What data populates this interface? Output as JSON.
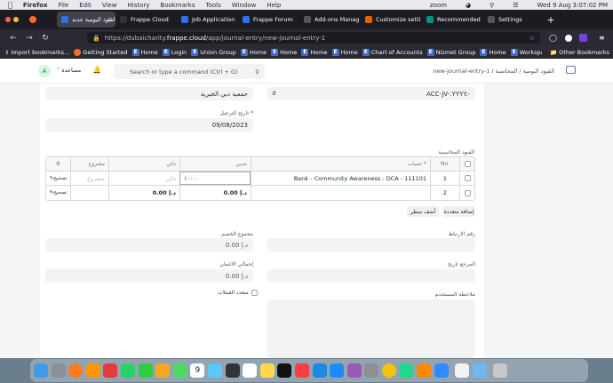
{
  "menubar": {
    "app": "Firefox",
    "items": [
      "File",
      "Edit",
      "View",
      "History",
      "Bookmarks",
      "Tools",
      "Window",
      "Help"
    ],
    "zoom": "zoom",
    "clock": "Wed 9 Aug  3:07:02 PM"
  },
  "tabs": [
    {
      "label": "القيود اليومية جديد -",
      "color": "#2e73e8",
      "active": true
    },
    {
      "label": "Frappe Cloud",
      "color": "#333"
    },
    {
      "label": "Job Application",
      "color": "#2e73e8"
    },
    {
      "label": "Frappe Forum",
      "color": "#2e73e8"
    },
    {
      "label": "Add-ons Manag",
      "color": "#555"
    },
    {
      "label": "Customize setti",
      "color": "#e66000"
    },
    {
      "label": "Recommended",
      "color": "#0a8f88"
    },
    {
      "label": "Settings",
      "color": "#555"
    }
  ],
  "url": {
    "prefix": "https://dubaicharity.",
    "domain": "frappe.cloud",
    "path": "/app/journal-entry/new-journal-entry-1"
  },
  "bookmarks": [
    {
      "label": "Import bookmarks...",
      "icon": "import-icon"
    },
    {
      "label": "Getting Started",
      "icon": "firefox-icon"
    },
    {
      "label": "Home",
      "icon": "e-icon"
    },
    {
      "label": "Login",
      "icon": "e-icon"
    },
    {
      "label": "Union Group",
      "icon": "e-icon"
    },
    {
      "label": "Home",
      "icon": "e-icon"
    },
    {
      "label": "Home",
      "icon": "e-icon"
    },
    {
      "label": "Home",
      "icon": "e-icon"
    },
    {
      "label": "Home",
      "icon": "e-icon"
    },
    {
      "label": "Chart of Accounts",
      "icon": "e-icon"
    },
    {
      "label": "Nizmet Group",
      "icon": "e-icon"
    },
    {
      "label": "Home",
      "icon": "e-icon"
    },
    {
      "label": "Workspace",
      "icon": "e-icon"
    },
    {
      "label": "Buying",
      "icon": "e-icon"
    },
    {
      "label": "Workspace",
      "icon": "e-icon"
    },
    {
      "label": "Home",
      "icon": "e-icon"
    }
  ],
  "other_bookmarks": "Other Bookmarks",
  "topnav": {
    "avatar": "A",
    "help": "مساعدة",
    "search_placeholder": "Search or type a command (Ctrl + G)",
    "breadcrumb": "new-journal-entry-1 / القيود اليومية / المحاسبة"
  },
  "form": {
    "series_value": "ACC-JV-.YYYY.-",
    "company_value": "جمعية دبي الخيرية",
    "posting_date_label": "تاريخ الترحيل *",
    "posting_date_value": "09/08/2023",
    "accounts_label": "القيود المحاسبية",
    "table_headers": {
      "no": "No.",
      "account": "حساب *",
      "debit": "مدين",
      "credit": "دائن",
      "project": "مشروع"
    },
    "rows": [
      {
        "no": "1",
        "account": "Bank - Community Awareness - DCA - 111101",
        "debit": "١٠٠٠",
        "credit": "دائن",
        "project": "مشروع",
        "edit": "تصحيح"
      },
      {
        "no": "2",
        "account": "",
        "debit": "",
        "credit": "",
        "project": "",
        "edit": "تصحيح"
      }
    ],
    "totals": {
      "debit": "0.00 د.إ",
      "credit": "0.00 د.إ"
    },
    "add_multiple": "إضافة متعددة",
    "add_row": "أضف سطر",
    "reference_number_label": "رقم الارتباط",
    "total_debit_label": "مجموع الخصم",
    "total_debit_value": "0.00 د.إ",
    "reference_date_label": "المرجع تاريخ",
    "total_credit_label": "إجمالي الائتمان",
    "total_credit_value": "0.00 د.إ",
    "user_remark_label": "ملاحظة المستخدم",
    "multi_currency_label": "متعدد العملات"
  },
  "dock_apps": [
    "finder",
    "launchpad",
    "firefox",
    "sublime",
    "remote",
    "whatsapp",
    "facetime",
    "photos",
    "maps",
    "calendar",
    "files",
    "terminal",
    "reminders",
    "notes",
    "appletv",
    "music",
    "vscode",
    "appstore",
    "podcasts",
    "settings",
    "chrome",
    "pycharm",
    "vlc",
    "zoom",
    "doc",
    "folder",
    "trash"
  ],
  "calendar_day": "9"
}
